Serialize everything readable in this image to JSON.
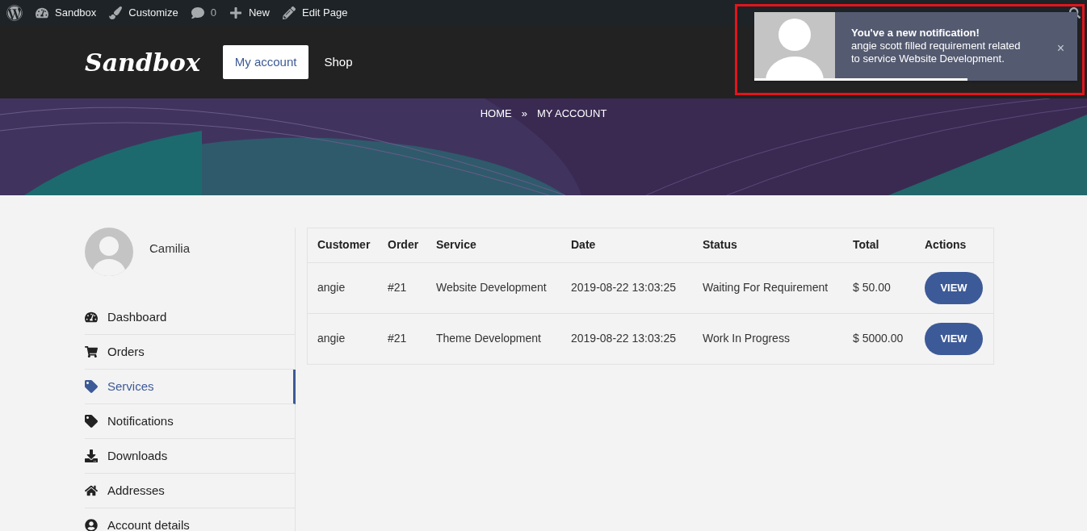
{
  "admin_bar": {
    "items": [
      {
        "kind": "wp"
      },
      {
        "kind": "site",
        "label": "Sandbox"
      },
      {
        "kind": "customize",
        "label": "Customize"
      },
      {
        "kind": "comments",
        "label": "0"
      },
      {
        "kind": "new",
        "label": "New"
      },
      {
        "kind": "edit",
        "label": "Edit Page"
      }
    ]
  },
  "header": {
    "logo": "Sandbox",
    "nav": [
      {
        "label": "My account",
        "selected": true
      },
      {
        "label": "Shop",
        "selected": false
      }
    ]
  },
  "breadcrumb": {
    "items": [
      "HOME",
      "MY ACCOUNT"
    ],
    "separator": "»"
  },
  "profile": {
    "name": "Camilia"
  },
  "sidebar": {
    "items": [
      {
        "label": "Dashboard",
        "selected": false
      },
      {
        "label": "Orders",
        "selected": false
      },
      {
        "label": "Services",
        "selected": true
      },
      {
        "label": "Notifications",
        "selected": false
      },
      {
        "label": "Downloads",
        "selected": false
      },
      {
        "label": "Addresses",
        "selected": false
      },
      {
        "label": "Account details",
        "selected": false
      }
    ]
  },
  "table": {
    "columns": [
      "Customer",
      "Order",
      "Service",
      "Date",
      "Status",
      "Total",
      "Actions"
    ],
    "rows": [
      {
        "cells": [
          "angie",
          "#21",
          "Website Development",
          "2019-08-22 13:03:25",
          "Waiting For Requirement",
          "$ 50.00"
        ],
        "action": "VIEW"
      },
      {
        "cells": [
          "angie",
          "#21",
          "Theme Development",
          "2019-08-22 13:03:25",
          "Work In Progress",
          "$ 5000.00"
        ],
        "action": "VIEW"
      }
    ]
  },
  "notification": {
    "title": "You've a new notification!",
    "message": "angie scott filled requirement related to service Website Development.",
    "close": "×",
    "level": 0.66,
    "highlighted": true
  }
}
